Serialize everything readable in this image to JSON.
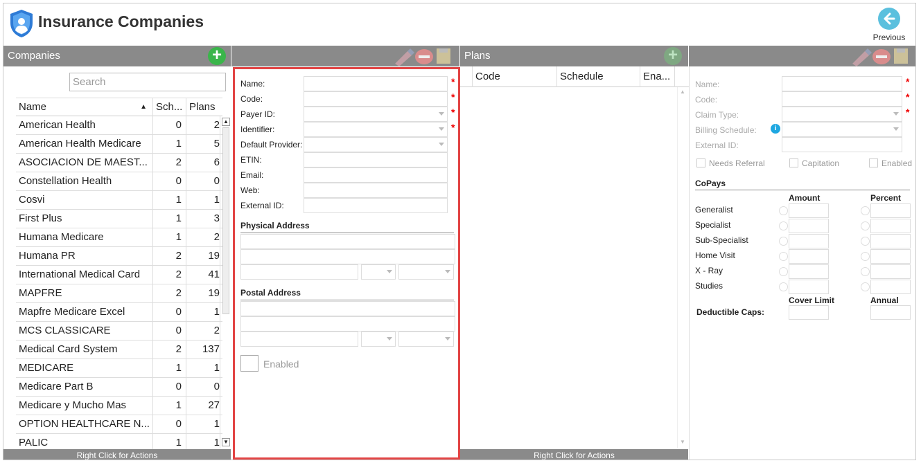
{
  "app": {
    "title": "Insurance Companies",
    "previous_label": "Previous"
  },
  "companies": {
    "panel_title": "Companies",
    "search_placeholder": "Search",
    "columns": {
      "name": "Name",
      "sch": "Sch...",
      "plans": "Plans"
    },
    "rows": [
      {
        "name": "American Health",
        "sch": "0",
        "plans": "2"
      },
      {
        "name": "American Health Medicare",
        "sch": "1",
        "plans": "5"
      },
      {
        "name": "ASOCIACION DE MAEST...",
        "sch": "2",
        "plans": "6"
      },
      {
        "name": "Constellation Health",
        "sch": "0",
        "plans": "0"
      },
      {
        "name": "Cosvi",
        "sch": "1",
        "plans": "1"
      },
      {
        "name": "First Plus",
        "sch": "1",
        "plans": "3"
      },
      {
        "name": "Humana Medicare",
        "sch": "1",
        "plans": "2"
      },
      {
        "name": "Humana PR",
        "sch": "2",
        "plans": "19"
      },
      {
        "name": "International Medical Card",
        "sch": "2",
        "plans": "41"
      },
      {
        "name": "MAPFRE",
        "sch": "2",
        "plans": "19"
      },
      {
        "name": "Mapfre Medicare Excel",
        "sch": "0",
        "plans": "1"
      },
      {
        "name": "MCS CLASSICARE",
        "sch": "0",
        "plans": "2"
      },
      {
        "name": "Medical Card System",
        "sch": "2",
        "plans": "137"
      },
      {
        "name": "MEDICARE",
        "sch": "1",
        "plans": "1"
      },
      {
        "name": "Medicare Part B",
        "sch": "0",
        "plans": "0"
      },
      {
        "name": "Medicare y Mucho Mas",
        "sch": "1",
        "plans": "27"
      },
      {
        "name": "OPTION HEALTHCARE N...",
        "sch": "0",
        "plans": "1"
      },
      {
        "name": "PALIC",
        "sch": "1",
        "plans": "1"
      }
    ],
    "footer": "Right Click for Actions"
  },
  "company_form": {
    "labels": {
      "name": "Name:",
      "code": "Code:",
      "payer_id": "Payer ID:",
      "identifier": "Identifier:",
      "default_provider": "Default Provider:",
      "etin": "ETIN:",
      "email": "Email:",
      "web": "Web:",
      "external_id": "External ID:"
    },
    "required_mark": "*",
    "physical_address": "Physical Address",
    "postal_address": "Postal Address",
    "enabled_label": "Enabled"
  },
  "plans": {
    "panel_title": "Plans",
    "columns": {
      "code": "Code",
      "schedule": "Schedule",
      "enabled": "Ena..."
    },
    "footer": "Right Click for Actions"
  },
  "plan_form": {
    "labels": {
      "name": "Name:",
      "code": "Code:",
      "claim_type": "Claim Type:",
      "billing_schedule": "Billing Schedule:",
      "external_id": "External ID:"
    },
    "required_mark": "*",
    "needs_referral": "Needs Referral",
    "capitation": "Capitation",
    "enabled": "Enabled",
    "copays_title": "CoPays",
    "amount": "Amount",
    "percent": "Percent",
    "copay_rows": [
      "Generalist",
      "Specialist",
      "Sub-Specialist",
      "Home Visit",
      "X - Ray",
      "Studies"
    ],
    "cover_limit": "Cover Limit",
    "annual": "Annual",
    "deductible_caps": "Deductible Caps:",
    "info_icon_glyph": "i"
  },
  "colors": {
    "accent_green": "#3ab54a",
    "header_gray": "#8a8a8a",
    "highlight_red": "#e24444",
    "info_blue": "#1ea7e1",
    "previous_blue": "#5bc0de"
  }
}
